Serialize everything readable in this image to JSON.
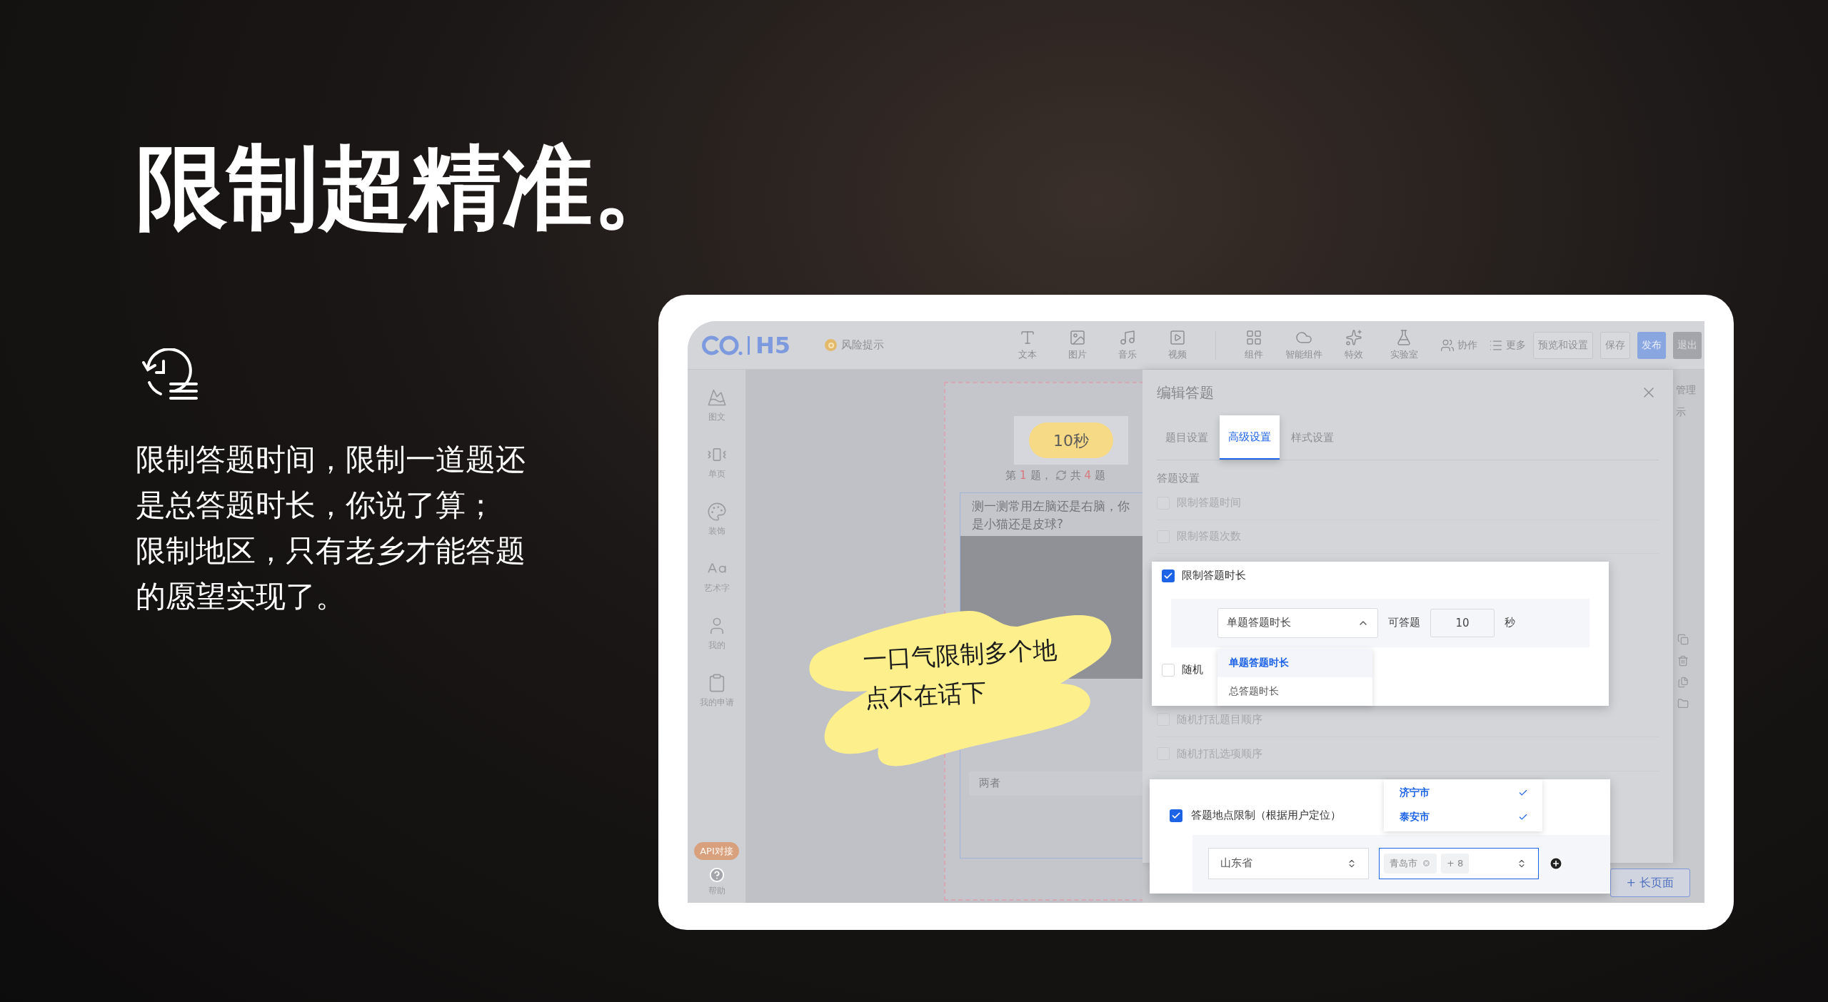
{
  "headline": "限制超精准。",
  "description_lines": [
    "限制答题时间，限制一道题还",
    "是总答题时长，你说了算；",
    "限制地区，只有老乡才能答题",
    "的愿望实现了。"
  ],
  "app": {
    "logo": "H5",
    "risk_notice": "风险提示",
    "tools": [
      {
        "label": "文本",
        "kind": "text"
      },
      {
        "label": "图片",
        "kind": "image"
      },
      {
        "label": "音乐",
        "kind": "music"
      },
      {
        "label": "视频",
        "kind": "video"
      },
      {
        "label": "组件",
        "kind": "components"
      },
      {
        "label": "智能组件",
        "kind": "ai"
      },
      {
        "label": "特效",
        "kind": "effects"
      },
      {
        "label": "实验室",
        "kind": "lab"
      }
    ],
    "inline_tools": [
      {
        "label": "协作",
        "kind": "team"
      },
      {
        "label": "更多",
        "kind": "more"
      }
    ],
    "buttons": [
      {
        "label": "预览和设置",
        "kind": "outline"
      },
      {
        "label": "保存",
        "kind": "outline"
      },
      {
        "label": "发布",
        "kind": "primary"
      },
      {
        "label": "退出",
        "kind": "dark"
      }
    ],
    "sidebar": [
      {
        "label": "图文",
        "kind": "mountain"
      },
      {
        "label": "单页",
        "kind": "page"
      },
      {
        "label": "装饰",
        "kind": "palette"
      },
      {
        "label": "艺术字",
        "kind": "font"
      },
      {
        "label": "我的",
        "kind": "user"
      },
      {
        "label": "我的申请",
        "kind": "clipboard"
      }
    ],
    "api_badge": "API对接",
    "help": "帮助",
    "preview": {
      "timer": "10秒",
      "progress": {
        "before": "第",
        "current": "1",
        "after_current": "题，",
        "total_label": "共",
        "total": "4",
        "after_total": "题"
      },
      "question_lines": [
        "测一测常用左脑还是右脑，你",
        "是小猫还是皮球?"
      ],
      "option": "两者"
    },
    "sticker_lines": [
      "一口气限制多个地",
      "点不在话下"
    ],
    "editor": {
      "title": "编辑答题",
      "tabs": [
        {
          "label": "题目设置",
          "selected": false
        },
        {
          "label": "高级设置",
          "selected": true
        },
        {
          "label": "样式设置",
          "selected": false
        }
      ],
      "section": "答题设置",
      "options_top": [
        {
          "label": "限制答题时间",
          "checked": false
        },
        {
          "label": "限制答题次数",
          "checked": false
        }
      ],
      "duration": {
        "label": "限制答题时长",
        "checked": true,
        "mode": "单题答题时长",
        "allow_label": "可答题",
        "seconds": "10",
        "unit": "秒",
        "mode_options": [
          {
            "label": "单题答题时长",
            "selected": true
          },
          {
            "label": "总答题时长",
            "selected": false
          }
        ],
        "next_row": {
          "label": "随机",
          "checked": false
        }
      },
      "options_middle": [
        {
          "label": "随机打乱题目顺序",
          "checked": false
        },
        {
          "label": "随机打乱选项顺序",
          "checked": false
        }
      ],
      "location": {
        "label": "答题地点限制（根据用户定位）",
        "checked": true,
        "province": "山东省",
        "city_tags": [
          {
            "label": "青岛市"
          }
        ],
        "more_count": "+ 8",
        "city_options": [
          {
            "label": "济宁市",
            "selected": true
          },
          {
            "label": "泰安市",
            "selected": true
          }
        ]
      }
    },
    "side_texts": [
      "管理",
      "示"
    ],
    "page_button": "+ 长页面"
  }
}
